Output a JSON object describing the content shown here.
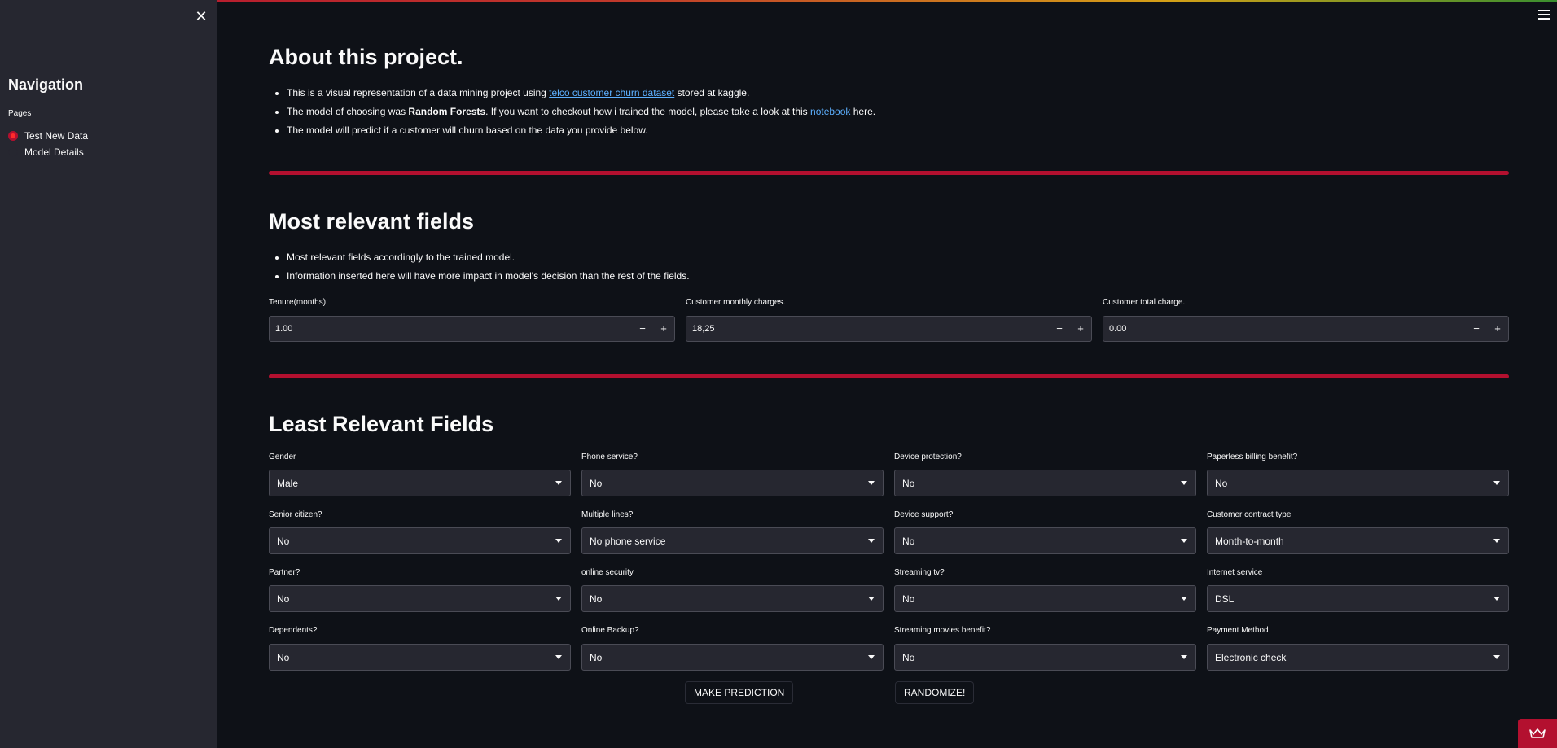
{
  "sidebar": {
    "title": "Navigation",
    "pages_label": "Pages",
    "pages": [
      {
        "label": "Test New Data",
        "selected": true
      },
      {
        "label": "Model Details",
        "selected": false
      }
    ],
    "close_icon": "close-icon"
  },
  "main": {
    "about": {
      "title": "About this project.",
      "bullets": {
        "b1_pre": "This is a visual representation of a data mining project using ",
        "b1_link": "telco customer churn dataset",
        "b1_post": " stored at kaggle.",
        "b2_pre": "The model of choosing was ",
        "b2_bold": "Random Forests",
        "b2_mid": ". If you want to checkout how i trained the model, please take a look at this ",
        "b2_link": "notebook",
        "b2_post": " here.",
        "b3": "The model will predict if a customer will churn based on the data you provide below."
      }
    },
    "relevant": {
      "title": "Most relevant fields",
      "bullets": [
        "Most relevant fields accordingly to the trained model.",
        "Information inserted here will have more impact in model's decision than the rest of the fields."
      ],
      "inputs": [
        {
          "label": "Tenure(months)",
          "value": "1.00"
        },
        {
          "label": "Customer monthly charges.",
          "value": "18,25"
        },
        {
          "label": "Customer total charge.",
          "value": "0.00"
        }
      ]
    },
    "least": {
      "title": "Least Relevant Fields",
      "selects": [
        {
          "label": "Gender",
          "value": "Male"
        },
        {
          "label": "Phone service?",
          "value": "No"
        },
        {
          "label": "Device protection?",
          "value": "No"
        },
        {
          "label": "Paperless billing benefit?",
          "value": "No"
        },
        {
          "label": "Senior citizen?",
          "value": "No"
        },
        {
          "label": "Multiple lines?",
          "value": "No phone service"
        },
        {
          "label": "Device support?",
          "value": "No"
        },
        {
          "label": "Customer contract type",
          "value": "Month-to-month"
        },
        {
          "label": "Partner?",
          "value": "No"
        },
        {
          "label": "online security",
          "value": "No"
        },
        {
          "label": "Streaming tv?",
          "value": "No"
        },
        {
          "label": "Internet service",
          "value": "DSL"
        },
        {
          "label": "Dependents?",
          "value": "No"
        },
        {
          "label": "Online Backup?",
          "value": "No"
        },
        {
          "label": "Streaming movies benefit?",
          "value": "No"
        },
        {
          "label": "Payment Method",
          "value": "Electronic check"
        }
      ]
    },
    "buttons": {
      "predict": "MAKE PREDICTION",
      "randomize": "RANDOMIZE!"
    }
  },
  "colors": {
    "background": "#0e1117",
    "sidebar": "#262730",
    "accent": "#b3102f",
    "link": "#5db0ff"
  }
}
